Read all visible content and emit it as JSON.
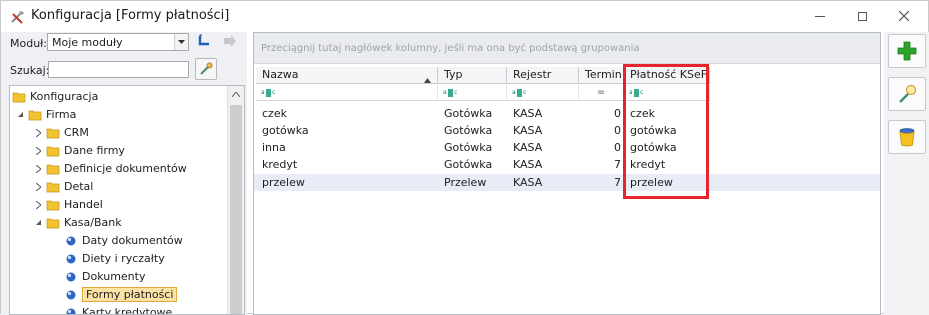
{
  "window": {
    "title": "Konfiguracja [Formy płatności]"
  },
  "left": {
    "module_label": "Moduł:",
    "module_value": "Moje moduły",
    "search_label": "Szukaj:",
    "search_value": ""
  },
  "tree": {
    "root": "Konfiguracja",
    "firma": "Firma",
    "crm": "CRM",
    "dane_firmy": "Dane firmy",
    "definicje": "Definicje dokumentów",
    "detal": "Detal",
    "handel": "Handel",
    "kasa_bank": "Kasa/Bank",
    "daty": "Daty dokumentów",
    "diety": "Diety i ryczałty",
    "dokumenty": "Dokumenty",
    "formy": "Formy płatności",
    "karty": "Karty kredytowe"
  },
  "grid": {
    "group_hint": "Przeciągnij tutaj nagłówek kolumny, jeśli ma ona być podstawą grupowania",
    "columns": {
      "nazwa": "Nazwa",
      "typ": "Typ",
      "rejestr": "Rejestr",
      "termin": "Termin",
      "ksef": "Płatność KSeF"
    },
    "filter_abc": "abc",
    "filter_eq": "=",
    "rows": [
      {
        "nazwa": "czek",
        "typ": "Gotówka",
        "rejestr": "KASA",
        "termin": "0",
        "ksef": "czek"
      },
      {
        "nazwa": "gotówka",
        "typ": "Gotówka",
        "rejestr": "KASA",
        "termin": "0",
        "ksef": "gotówka"
      },
      {
        "nazwa": "inna",
        "typ": "Gotówka",
        "rejestr": "KASA",
        "termin": "0",
        "ksef": "gotówka"
      },
      {
        "nazwa": "kredyt",
        "typ": "Gotówka",
        "rejestr": "KASA",
        "termin": "7",
        "ksef": "kredyt"
      },
      {
        "nazwa": "przelew",
        "typ": "Przelew",
        "rejestr": "KASA",
        "termin": "7",
        "ksef": "przelew"
      }
    ]
  },
  "colors": {
    "highlight_border": "#e5252b",
    "tree_selected": "#fbe3a6",
    "row_selected": "#e8ecf6",
    "add_green": "#2aa52a"
  },
  "icons": {
    "title": "tools-icon",
    "add": "plus-icon",
    "edit": "magnifier-icon",
    "delete": "trash-icon"
  }
}
